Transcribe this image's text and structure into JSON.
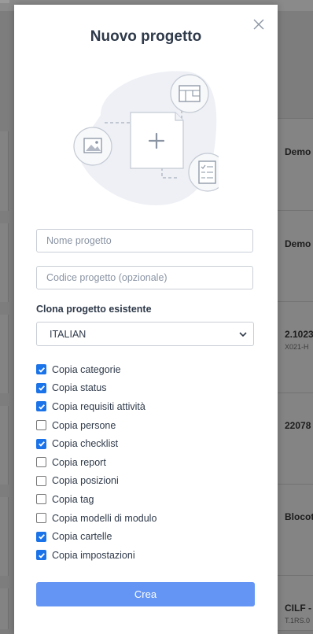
{
  "background": {
    "cards": [
      {
        "title": "Demo",
        "subtitle": ""
      },
      {
        "title": "Demo",
        "subtitle": ""
      },
      {
        "title": "2.1023",
        "subtitle": "X021-H"
      },
      {
        "title": "22078",
        "subtitle": ""
      },
      {
        "title": "Blocot",
        "subtitle": ""
      },
      {
        "title": "CILF -",
        "subtitle": "T.1RS.0"
      }
    ]
  },
  "modal": {
    "title": "Nuovo progetto",
    "name_placeholder": "Nome progetto",
    "code_placeholder": "Codice progetto (opzionale)",
    "clone_label": "Clona progetto esistente",
    "clone_selected": "ITALIAN",
    "options": [
      {
        "label": "Copia categorie",
        "checked": true
      },
      {
        "label": "Copia status",
        "checked": true
      },
      {
        "label": "Copia requisiti attività",
        "checked": true
      },
      {
        "label": "Copia persone",
        "checked": false
      },
      {
        "label": "Copia checklist",
        "checked": true
      },
      {
        "label": "Copia report",
        "checked": false
      },
      {
        "label": "Copia posizioni",
        "checked": false
      },
      {
        "label": "Copia tag",
        "checked": false
      },
      {
        "label": "Copia modelli di modulo",
        "checked": false
      },
      {
        "label": "Copia cartelle",
        "checked": true
      },
      {
        "label": "Copia impostazioni",
        "checked": true
      }
    ],
    "submit_label": "Crea"
  },
  "colors": {
    "accent": "#1a73e8",
    "button": "#6495f4",
    "text": "#2f3a4a",
    "overlay": "#7d7d7d"
  },
  "icons": [
    "close-icon",
    "image-icon",
    "plus-icon",
    "layout-icon",
    "checklist-icon",
    "chevron-down-icon",
    "checkmark-icon"
  ]
}
